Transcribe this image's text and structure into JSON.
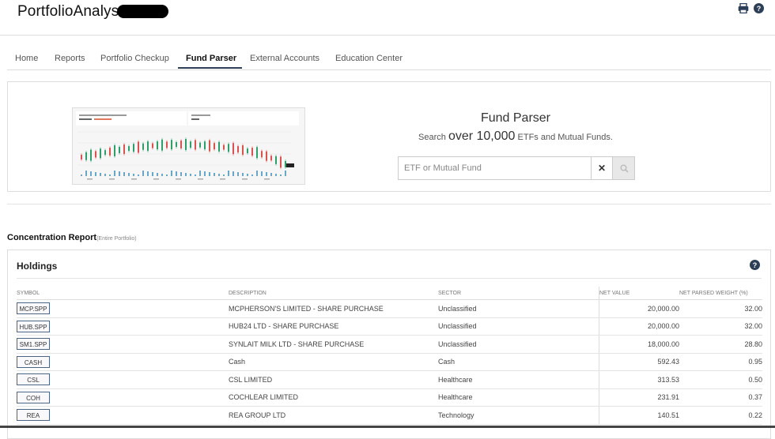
{
  "app": {
    "title": "PortfolioAnalyst"
  },
  "header": {
    "icons": [
      "print-icon",
      "help-icon"
    ]
  },
  "nav": {
    "tabs": [
      {
        "label": "Home"
      },
      {
        "label": "Reports"
      },
      {
        "label": "Portfolio Checkup"
      },
      {
        "label": "Fund Parser",
        "active": true
      },
      {
        "label": "External Accounts"
      },
      {
        "label": "Education Center"
      }
    ]
  },
  "fund_parser": {
    "title": "Fund Parser",
    "sub_pre": "Search",
    "sub_big": "over 10,000",
    "sub_post": "ETFs and Mutual Funds.",
    "search_placeholder": "ETF or Mutual Fund",
    "clear_label": "✕"
  },
  "concentration": {
    "title": "Concentration Report",
    "scope": "(Entire Portfolio)"
  },
  "holdings": {
    "title": "Holdings",
    "columns": [
      "SYMBOL",
      "DESCRIPTION",
      "SECTOR",
      "NET VALUE",
      "NET PARSED WEIGHT (%)"
    ],
    "rows": [
      {
        "symbol": "MCP.SPP",
        "description": "MCPHERSON'S LIMITED - SHARE PURCHASE",
        "sector": "Unclassified",
        "net_value": "20,000.00",
        "weight": "32.00"
      },
      {
        "symbol": "HUB.SPP",
        "description": "HUB24 LTD - SHARE PURCHASE",
        "sector": "Unclassified",
        "net_value": "20,000.00",
        "weight": "32.00"
      },
      {
        "symbol": "SM1.SPP",
        "description": "SYNLAIT MILK LTD - SHARE PURCHASE",
        "sector": "Unclassified",
        "net_value": "18,000.00",
        "weight": "28.80"
      },
      {
        "symbol": "CASH",
        "description": "Cash",
        "sector": "Cash",
        "net_value": "592.43",
        "weight": "0.95"
      },
      {
        "symbol": "CSL",
        "description": "CSL LIMITED",
        "sector": "Healthcare",
        "net_value": "313.53",
        "weight": "0.50"
      },
      {
        "symbol": "COH",
        "description": "COCHLEAR LIMITED",
        "sector": "Healthcare",
        "net_value": "231.91",
        "weight": "0.37"
      },
      {
        "symbol": "REA",
        "description": "REA GROUP LTD",
        "sector": "Technology",
        "net_value": "140.51",
        "weight": "0.22"
      }
    ]
  },
  "colors": {
    "accent": "#2d3f57",
    "help_icon": "#2d3f57",
    "candle_up": "#2e9e6a",
    "candle_down": "#d9534f"
  }
}
